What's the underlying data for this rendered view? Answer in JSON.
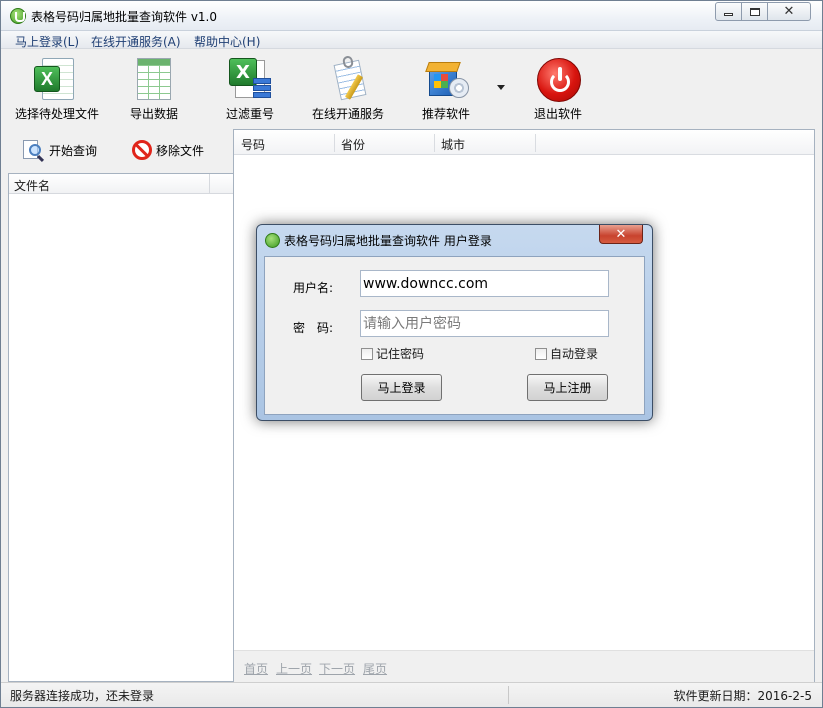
{
  "window": {
    "title": "表格号码归属地批量查询软件 v1.0"
  },
  "menu": {
    "items": [
      {
        "label": "马上登录(L)"
      },
      {
        "label": "在线开通服务(A)"
      },
      {
        "label": "帮助中心(H)"
      }
    ]
  },
  "toolbar": {
    "select_file": "选择待处理文件",
    "export_data": "导出数据",
    "filter_dup": "过滤重号",
    "online_service": "在线开通服务",
    "recommend": "推荐软件",
    "exit": "退出软件"
  },
  "left": {
    "start_query": "开始查询",
    "remove_file": "移除文件",
    "column_filename": "文件名"
  },
  "grid": {
    "columns": [
      "号码",
      "省份",
      "城市"
    ]
  },
  "pager": {
    "first": "首页",
    "prev": "上一页",
    "next": "下一页",
    "last": "尾页"
  },
  "status": {
    "left": "服务器连接成功，还未登录",
    "right": "软件更新日期：2016-2-5"
  },
  "login": {
    "title": "表格号码归属地批量查询软件 用户登录",
    "username_label": "用户名:",
    "username_value": "www.downcc.com",
    "password_label": "密　码:",
    "password_placeholder": "请输入用户密码",
    "remember": "记住密码",
    "auto_login": "自动登录",
    "login_button": "马上登录",
    "register_button": "马上注册"
  }
}
